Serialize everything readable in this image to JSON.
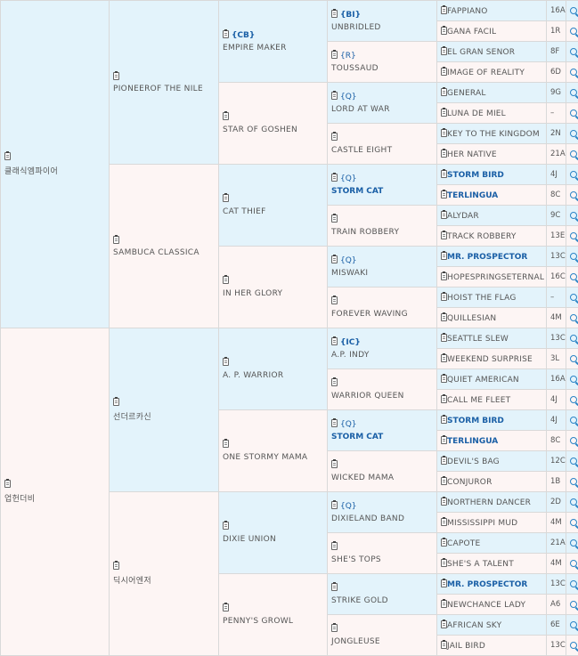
{
  "pedigree": {
    "sire": "클래식엠파이어",
    "dam": "업헌더비",
    "gen2": [
      {
        "name": "PIONEEROF THE NILE"
      },
      {
        "name": "SAMBUCA CLASSICA"
      },
      {
        "name": "선더르카신"
      },
      {
        "name": "딕시어엔저"
      }
    ],
    "gen3": [
      {
        "name": "EMPIRE MAKER",
        "badge": "{CB}"
      },
      {
        "name": "STAR OF GOSHEN",
        "badge": ""
      },
      {
        "name": "CAT THIEF",
        "badge": ""
      },
      {
        "name": "IN HER GLORY",
        "badge": ""
      },
      {
        "name": "A. P. WARRIOR",
        "badge": ""
      },
      {
        "name": "ONE STORMY MAMA",
        "badge": ""
      },
      {
        "name": "DIXIE UNION",
        "badge": ""
      },
      {
        "name": "PENNY'S GROWL",
        "badge": ""
      }
    ],
    "gen4": [
      {
        "name": "UNBRIDLED",
        "badge": "{BI}"
      },
      {
        "name": "TOUSSAUD",
        "badge": "{R}"
      },
      {
        "name": "LORD AT WAR",
        "badge": "{Q}"
      },
      {
        "name": "CASTLE EIGHT",
        "badge": ""
      },
      {
        "name": "STORM CAT",
        "badge": "{Q}"
      },
      {
        "name": "TRAIN ROBBERY",
        "badge": ""
      },
      {
        "name": "MISWAKI",
        "badge": "{Q}"
      },
      {
        "name": "FOREVER WAVING",
        "badge": ""
      },
      {
        "name": "A.P. INDY",
        "badge": "{IC}"
      },
      {
        "name": "WARRIOR QUEEN",
        "badge": ""
      },
      {
        "name": "STORM CAT",
        "badge": "{Q}"
      },
      {
        "name": "WICKED MAMA",
        "badge": ""
      },
      {
        "name": "DIXIELAND BAND",
        "badge": "{Q}"
      },
      {
        "name": "SHE'S TOPS",
        "badge": ""
      },
      {
        "name": "STRIKE GOLD",
        "badge": ""
      },
      {
        "name": "JONGLEUSE",
        "badge": ""
      }
    ],
    "gen5": [
      {
        "name": "FAPPIANO",
        "code": "16A"
      },
      {
        "name": "GANA FACIL",
        "code": "1R"
      },
      {
        "name": "EL GRAN SENOR",
        "code": "8F"
      },
      {
        "name": "IMAGE OF REALITY",
        "code": "6D"
      },
      {
        "name": "GENERAL",
        "code": "9G"
      },
      {
        "name": "LUNA DE MIEL",
        "code": "–"
      },
      {
        "name": "KEY TO THE KINGDOM",
        "code": "2N"
      },
      {
        "name": "HER NATIVE",
        "code": "21A"
      },
      {
        "name": "STORM BIRD",
        "code": "4J"
      },
      {
        "name": "TERLINGUA",
        "code": "8C"
      },
      {
        "name": "ALYDAR",
        "code": "9C"
      },
      {
        "name": "TRACK ROBBERY",
        "code": "13E"
      },
      {
        "name": "MR. PROSPECTOR",
        "code": "13C"
      },
      {
        "name": "HOPESPRINGSETERNAL",
        "code": "16C"
      },
      {
        "name": "HOIST THE FLAG",
        "code": "–"
      },
      {
        "name": "QUILLESIAN",
        "code": "4M"
      },
      {
        "name": "SEATTLE SLEW",
        "code": "13C"
      },
      {
        "name": "WEEKEND SURPRISE",
        "code": "3L"
      },
      {
        "name": "QUIET AMERICAN",
        "code": "16A"
      },
      {
        "name": "CALL ME FLEET",
        "code": "4J"
      },
      {
        "name": "STORM BIRD",
        "code": "4J"
      },
      {
        "name": "TERLINGUA",
        "code": "8C"
      },
      {
        "name": "DEVIL'S BAG",
        "code": "12C"
      },
      {
        "name": "CONJUROR",
        "code": "1B"
      },
      {
        "name": "NORTHERN DANCER",
        "code": "2D"
      },
      {
        "name": "MISSISSIPPI MUD",
        "code": "4M"
      },
      {
        "name": "CAPOTE",
        "code": "21A"
      },
      {
        "name": "SHE'S A TALENT",
        "code": "4M"
      },
      {
        "name": "MR. PROSPECTOR",
        "code": "13C"
      },
      {
        "name": "NEWCHANCE LADY",
        "code": "A6"
      },
      {
        "name": "AFRICAN SKY",
        "code": "6E"
      },
      {
        "name": "JAIL BIRD",
        "code": "13C"
      }
    ]
  }
}
